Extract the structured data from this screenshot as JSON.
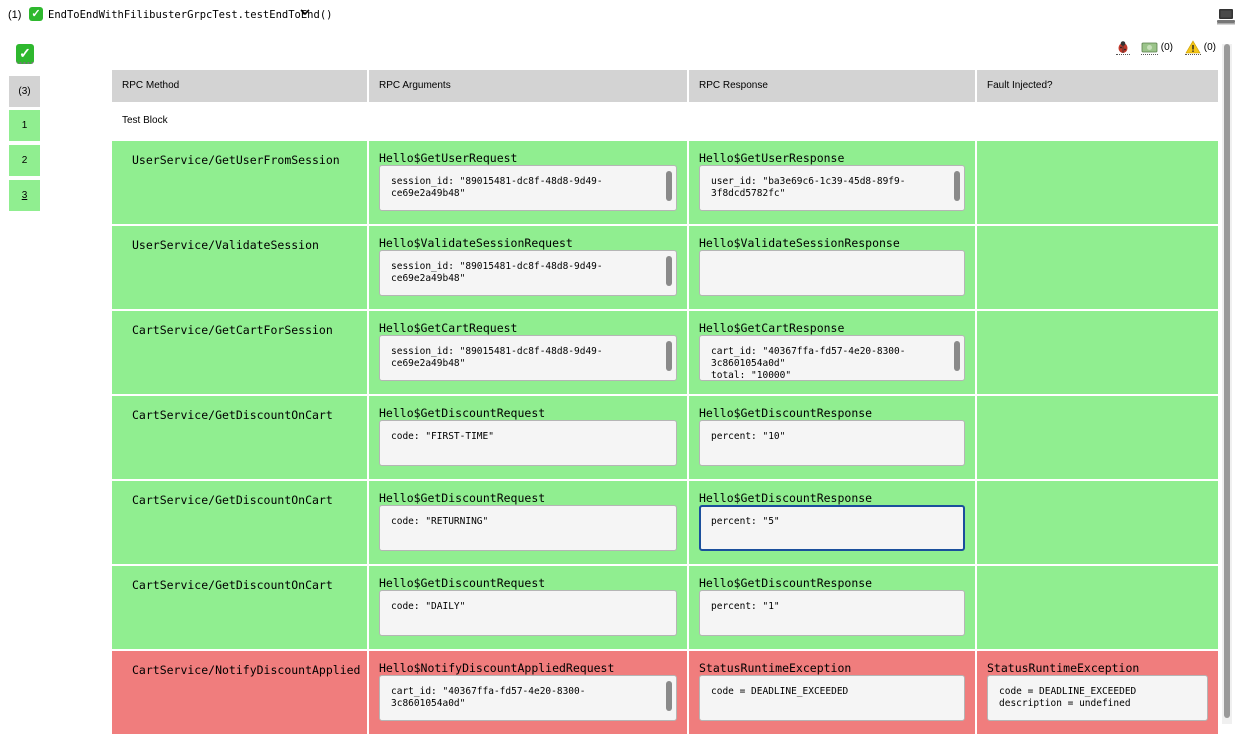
{
  "topbar": {
    "run_count": "(1)",
    "test_title": "EndToEndWithFilibusterGrpcTest.testEndToEnd()",
    "chevron": "⌄"
  },
  "left_panel": {
    "tabs": [
      "(3)",
      "1",
      "2",
      "3"
    ],
    "selected_tab": "3"
  },
  "indicators": {
    "bug_icon": "bug-icon",
    "money_icon": "money-icon",
    "money_count": "(0)",
    "warning_icon": "warning-icon",
    "warning_count": "(0)"
  },
  "table": {
    "headers": [
      "RPC Method",
      "RPC Arguments",
      "RPC Response",
      "Fault Injected?"
    ],
    "block_label": "Test Block",
    "rows": [
      {
        "status": "success",
        "method": "UserService/GetUserFromSession",
        "req_type": "Hello$GetUserRequest",
        "req_body": "session_id: \"89015481-dc8f-48d8-9d49-\nce69e2a49b48\"",
        "res_type": "Hello$GetUserResponse",
        "res_body": "user_id: \"ba3e69c6-1c39-45d8-89f9-\n3f8dcd5782fc\"",
        "fault_type": "",
        "fault_body": ""
      },
      {
        "status": "success",
        "method": "UserService/ValidateSession",
        "req_type": "Hello$ValidateSessionRequest",
        "req_body": "session_id: \"89015481-dc8f-48d8-9d49-\nce69e2a49b48\"",
        "res_type": "Hello$ValidateSessionResponse",
        "res_body": "",
        "fault_type": "",
        "fault_body": ""
      },
      {
        "status": "success",
        "method": "CartService/GetCartForSession",
        "req_type": "Hello$GetCartRequest",
        "req_body": "session_id: \"89015481-dc8f-48d8-9d49-\nce69e2a49b48\"",
        "res_type": "Hello$GetCartResponse",
        "res_body": "cart_id: \"40367ffa-fd57-4e20-8300-\n3c8601054a0d\"\ntotal: \"10000\"",
        "fault_type": "",
        "fault_body": ""
      },
      {
        "status": "success",
        "method": "CartService/GetDiscountOnCart",
        "req_type": "Hello$GetDiscountRequest",
        "req_body": "code: \"FIRST-TIME\"",
        "res_type": "Hello$GetDiscountResponse",
        "res_body": "percent: \"10\"",
        "fault_type": "",
        "fault_body": ""
      },
      {
        "status": "success",
        "method": "CartService/GetDiscountOnCart",
        "req_type": "Hello$GetDiscountRequest",
        "req_body": "code: \"RETURNING\"",
        "res_type": "Hello$GetDiscountResponse",
        "res_body": "percent: \"5\"",
        "fault_type": "",
        "fault_body": ""
      },
      {
        "status": "success",
        "method": "CartService/GetDiscountOnCart",
        "req_type": "Hello$GetDiscountRequest",
        "req_body": "code: \"DAILY\"",
        "res_type": "Hello$GetDiscountResponse",
        "res_body": "percent: \"1\"",
        "fault_type": "",
        "fault_body": ""
      },
      {
        "status": "failure",
        "method": "CartService/NotifyDiscountApplied",
        "req_type": "Hello$NotifyDiscountAppliedRequest",
        "req_body": "cart_id: \"40367ffa-fd57-4e20-8300-\n3c8601054a0d\"",
        "res_type": "StatusRuntimeException",
        "res_body": "code = DEADLINE_EXCEEDED",
        "fault_type": "StatusRuntimeException",
        "fault_body": "code = DEADLINE_EXCEEDED\ndescription = undefined"
      }
    ]
  },
  "colors": {
    "success": "#90ee90",
    "failure": "#f07d7d",
    "header": "#d3d3d3",
    "focus": "#1b4f9c"
  }
}
